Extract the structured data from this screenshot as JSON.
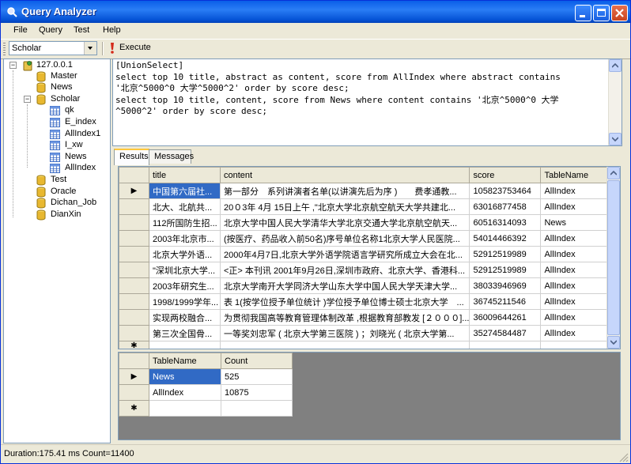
{
  "window": {
    "title": "Query Analyzer"
  },
  "menu": [
    "File",
    "Query",
    "Test",
    "Help"
  ],
  "toolbar": {
    "database": "Scholar",
    "execute_label": "Execute"
  },
  "tree": {
    "server": "127.0.0.1",
    "databases": [
      {
        "name": "Master"
      },
      {
        "name": "News"
      },
      {
        "name": "Scholar",
        "tables": [
          "qk",
          "E_index",
          "AllIndex1",
          "I_xw",
          "News",
          "AllIndex"
        ]
      },
      {
        "name": "Test"
      },
      {
        "name": "Oracle"
      },
      {
        "name": "Dichan_Job"
      },
      {
        "name": "DianXin"
      }
    ]
  },
  "editor": {
    "lines": [
      "[UnionSelect]",
      "select top 10 title, abstract as content, score from AllIndex where abstract contains",
      "'北京^5000^0 大学^5000^2' order by score desc;",
      "select top 10 title, content, score from News where content contains '北京^5000^0 大学",
      "^5000^2' order by score desc;"
    ]
  },
  "tabs": [
    "Results",
    "Messages"
  ],
  "results": {
    "columns": [
      "title",
      "content",
      "score",
      "TableName"
    ],
    "rows": [
      [
        "中国第六届社...",
        "第一部分　系列讲演者名单(以讲演先后为序 )　　费孝通教...",
        "105823753464",
        "AllIndex"
      ],
      [
        "北大、北航共...",
        "20０3年 4月 15日上午 ,\"北京大学北京航空航天大学共建北...",
        "63016877458",
        "AllIndex"
      ],
      [
        "112所国防生招...",
        "北京大学中国人民大学清华大学北京交通大学北京航空航天...",
        "60516314093",
        "News"
      ],
      [
        "2003年北京市...",
        "(按医疗、药品收入前50名)序号单位名称1北京大学人民医院...",
        "54014466392",
        "AllIndex"
      ],
      [
        "北京大学外语...",
        "2000年4月7日,北京大学外语学院语言学研究所成立大会在北...",
        "52912519989",
        "AllIndex"
      ],
      [
        "\"深圳北京大学...",
        "<正> 本刊讯 2001年9月26日,深圳市政府、北京大学、香港科...",
        "52912519989",
        "AllIndex"
      ],
      [
        "2003年研究生...",
        "北京大学南开大学同济大学山东大学中国人民大学天津大学...",
        "38033946969",
        "AllIndex"
      ],
      [
        "1998/1999学年...",
        "表 1(按学位授予单位统计 )学位授予单位博士硕士北京大学　...",
        "36745211546",
        "AllIndex"
      ],
      [
        "实现两校融合...",
        "为贯彻我国高等教育管理体制改革 ,根据教育部教发 [２０００]...",
        "36009644261",
        "AllIndex"
      ],
      [
        "第三次全国骨...",
        "一等奖刘忠军 ( 北京大学第三医院 ) ；刘晓光 ( 北京大学第...",
        "35274584487",
        "AllIndex"
      ]
    ]
  },
  "counts": {
    "columns": [
      "TableName",
      "Count"
    ],
    "rows": [
      [
        "News",
        "525"
      ],
      [
        "AllIndex",
        "10875"
      ]
    ]
  },
  "status": "Duration:175.41 ms Count=11400"
}
